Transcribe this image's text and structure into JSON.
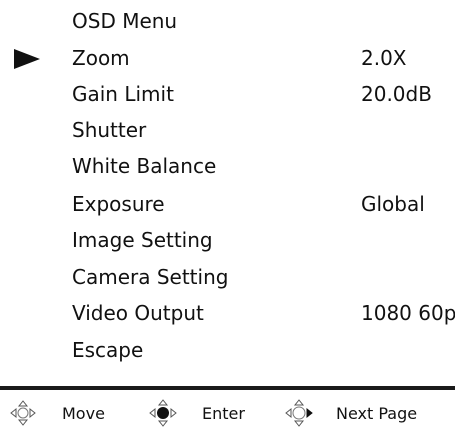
{
  "menu": {
    "title": "OSD Menu",
    "selected_index": 0,
    "items": [
      {
        "label": "Zoom",
        "value": "2.0X"
      },
      {
        "label": "Gain Limit",
        "value": "20.0dB"
      },
      {
        "label": "Shutter",
        "value": ""
      },
      {
        "label": "White Balance",
        "value": ""
      },
      {
        "label": "Exposure",
        "value": "Global"
      },
      {
        "label": "Image Setting",
        "value": ""
      },
      {
        "label": "Camera Setting",
        "value": ""
      },
      {
        "label": "Video Output",
        "value": "1080 60p"
      },
      {
        "label": "Escape",
        "value": ""
      }
    ]
  },
  "footer": {
    "move_label": "Move",
    "enter_label": "Enter",
    "next_page_label": "Next Page",
    "move_icon": "dpad-all-directions-icon",
    "enter_icon": "dpad-center-icon",
    "next_page_icon": "dpad-right-icon"
  },
  "colors": {
    "background": "#ffffff",
    "text": "#111111"
  }
}
